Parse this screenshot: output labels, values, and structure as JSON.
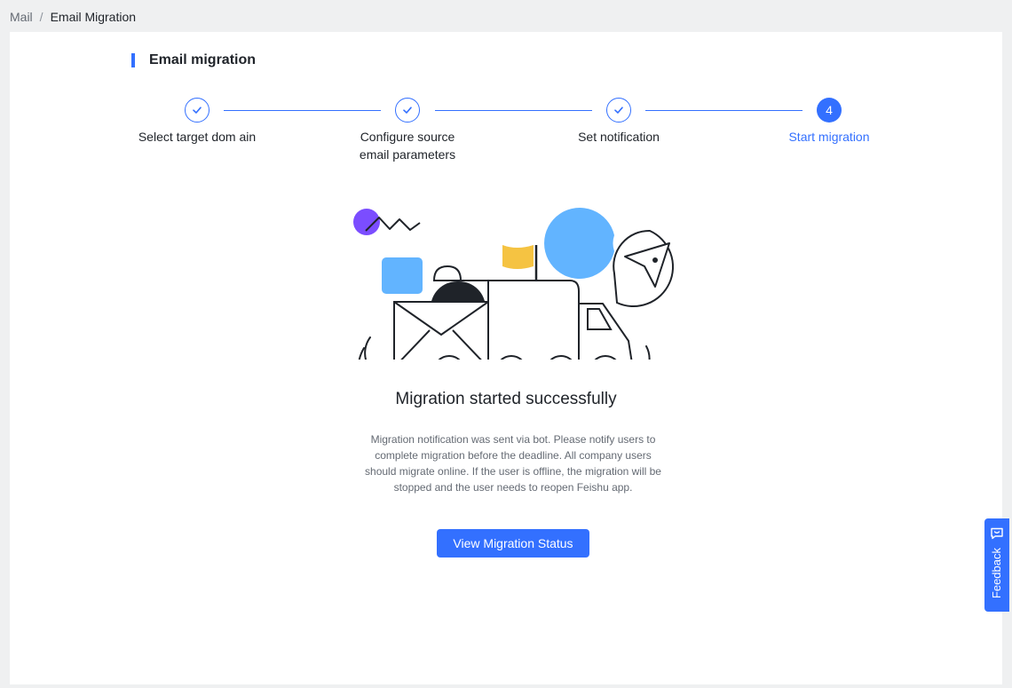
{
  "breadcrumb": {
    "root": "Mail",
    "separator": "/",
    "current": "Email Migration"
  },
  "section": {
    "title": "Email migration"
  },
  "steps": [
    {
      "label": "Select target dom ain",
      "status": "done",
      "icon": "check-icon"
    },
    {
      "label": "Configure source email parameters",
      "status": "done",
      "icon": "check-icon"
    },
    {
      "label": "Set notification",
      "status": "done",
      "icon": "check-icon"
    },
    {
      "label": "Start migration",
      "status": "active",
      "number": "4"
    }
  ],
  "result": {
    "title": "Migration started successfully",
    "description": "Migration notification was sent via bot. Please notify users to complete migration before the deadline. All company users should migrate online. If the user is offline, the migration will be stopped and the user needs to reopen Feishu app.",
    "button_label": "View Migration Status"
  },
  "feedback": {
    "label": "Feedback",
    "icon": "feedback-icon"
  },
  "colors": {
    "accent": "#3370ff",
    "background": "#eff0f1",
    "text": "#1f2329",
    "muted": "#646a73"
  }
}
